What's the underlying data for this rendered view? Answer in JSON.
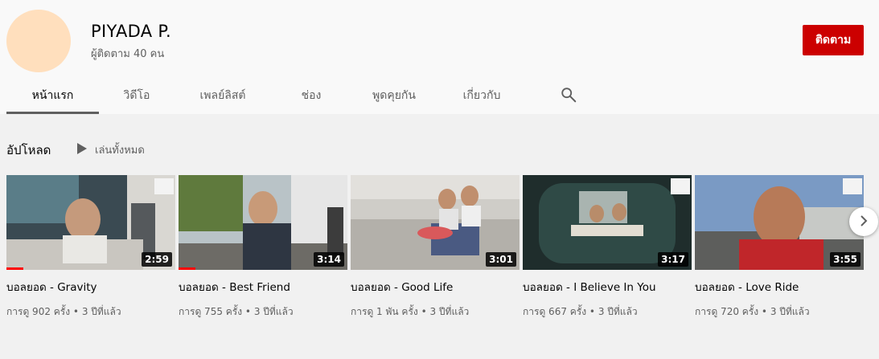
{
  "channel": {
    "name": "PIYADA P.",
    "subscribers": "ผู้ติดตาม 40 คน",
    "subscribe_label": "ติดตาม",
    "avatar_color": "#ffdfbd"
  },
  "tabs": [
    {
      "label": "หน้าแรก",
      "active": true
    },
    {
      "label": "วิดีโอ"
    },
    {
      "label": "เพลย์ลิสต์"
    },
    {
      "label": "ช่อง"
    },
    {
      "label": "พูดคุยกัน"
    },
    {
      "label": "เกี่ยวกับ"
    }
  ],
  "search_icon": "search-icon",
  "section": {
    "title": "อัปโหลด",
    "play_all": "เล่นทั้งหมด"
  },
  "videos": [
    {
      "title": "บอลยอด - Gravity",
      "duration": "2:59",
      "views": "การดู 902 ครั้ง",
      "age": "3 ปีที่แล้ว",
      "watched_fraction": 0.1
    },
    {
      "title": "บอลยอด - Best Friend",
      "duration": "3:14",
      "views": "การดู 755 ครั้ง",
      "age": "3 ปีที่แล้ว",
      "watched_fraction": 0.1
    },
    {
      "title": "บอลยอด - Good Life",
      "duration": "3:01",
      "views": "การดู 1 พัน ครั้ง",
      "age": "3 ปีที่แล้ว",
      "watched_fraction": 0
    },
    {
      "title": "บอลยอด - I Believe In You",
      "duration": "3:17",
      "views": "การดู 667 ครั้ง",
      "age": "3 ปีที่แล้ว",
      "watched_fraction": 0
    },
    {
      "title": "บอลยอด - Love Ride",
      "duration": "3:55",
      "views": "การดู 720 ครั้ง",
      "age": "3 ปีที่แล้ว",
      "watched_fraction": 0
    }
  ],
  "colors": {
    "subscribe": "#cc0000",
    "progress": "#ff0000"
  }
}
